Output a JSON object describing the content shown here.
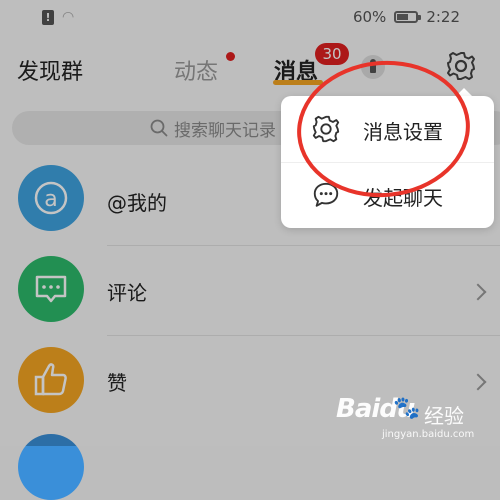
{
  "status_bar": {
    "battery_text": "60%",
    "battery_level": 0.6,
    "time": "2:22"
  },
  "top_nav": {
    "discover": "发现群",
    "moments": "动态",
    "messages": "消息",
    "messages_badge": "30"
  },
  "search": {
    "placeholder": "搜索聊天记录"
  },
  "list": {
    "items": [
      {
        "label": "@我的",
        "icon": "at-icon",
        "color": "#3fa3e0"
      },
      {
        "label": "评论",
        "icon": "comment-icon",
        "color": "#2dbb6b"
      },
      {
        "label": "赞",
        "icon": "thumbs-up-icon",
        "color": "#f5a623"
      }
    ]
  },
  "popup_menu": {
    "items": [
      {
        "label": "消息设置",
        "icon": "gear-icon"
      },
      {
        "label": "发起聊天",
        "icon": "chat-bubble-icon"
      }
    ]
  },
  "annotation": {
    "color": "#e8342a"
  },
  "watermark": {
    "brand": "Baidu",
    "product": "经验",
    "url": "jingyan.baidu.com"
  }
}
